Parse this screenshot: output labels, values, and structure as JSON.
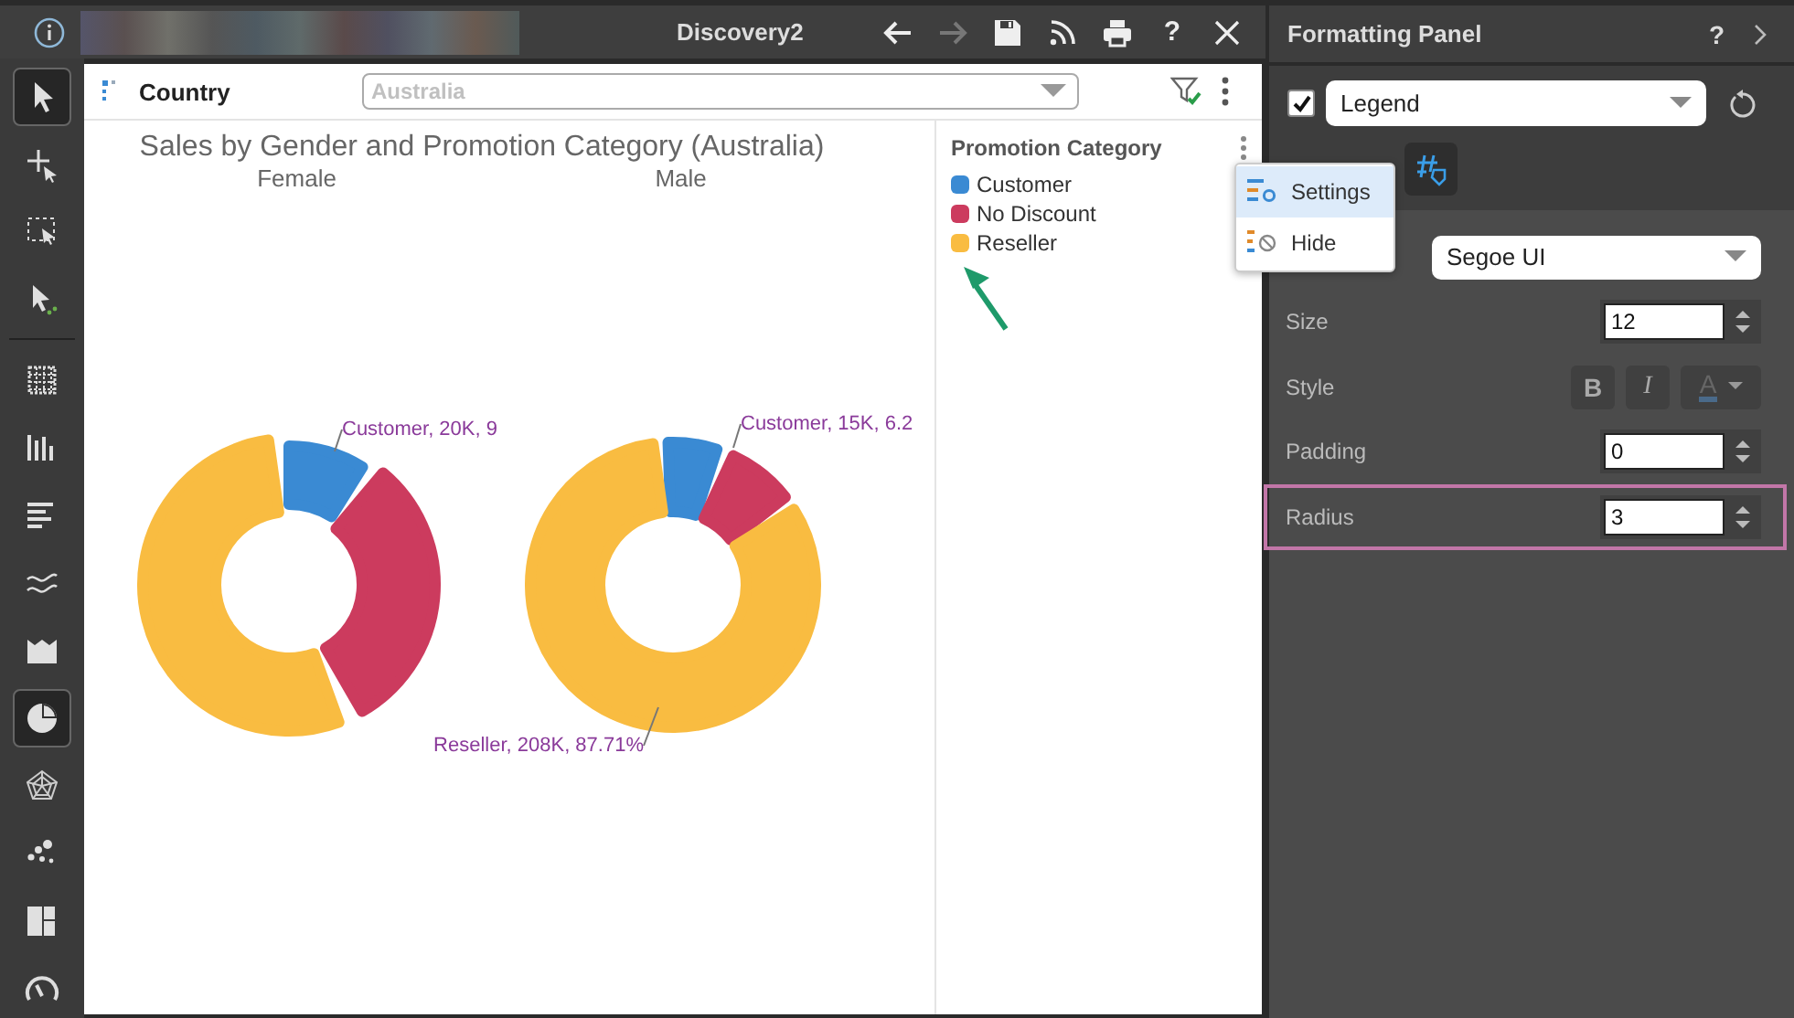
{
  "window": {
    "title": "Discovery2"
  },
  "toolbar_actions": [
    {
      "kind": "back",
      "disabled": false
    },
    {
      "kind": "forward",
      "disabled": true
    },
    {
      "kind": "save",
      "disabled": false
    },
    {
      "kind": "feed",
      "disabled": false
    },
    {
      "kind": "print",
      "disabled": false
    },
    {
      "kind": "help",
      "label": "?",
      "disabled": false
    },
    {
      "kind": "close",
      "disabled": false
    }
  ],
  "tools": [
    {
      "kind": "pointer",
      "selected": true
    },
    {
      "kind": "add-pointer",
      "selected": false
    },
    {
      "kind": "marquee",
      "selected": false
    },
    {
      "kind": "dot-pointer",
      "selected": false
    },
    {
      "kind": "divider"
    },
    {
      "kind": "grid",
      "selected": false
    },
    {
      "kind": "bars",
      "selected": false
    },
    {
      "kind": "hbars",
      "selected": false
    },
    {
      "kind": "lines",
      "selected": false
    },
    {
      "kind": "area",
      "selected": false
    },
    {
      "kind": "pie",
      "selected": true
    },
    {
      "kind": "radar",
      "selected": false
    },
    {
      "kind": "scatter",
      "selected": false
    },
    {
      "kind": "treemap",
      "selected": false
    },
    {
      "kind": "gauge",
      "selected": false
    }
  ],
  "filter": {
    "label": "Country",
    "value": "Australia",
    "disabled": true
  },
  "chart": {
    "title": "Sales by Gender and Promotion Category (Australia)",
    "panels": [
      {
        "subtitle": "Female",
        "labels": [
          "Customer, 20K, 9"
        ]
      },
      {
        "subtitle": "Male",
        "labels": [
          "Customer, 15K, 6.2",
          "Reseller, 208K, 87.71%"
        ]
      }
    ]
  },
  "legend": {
    "title": "Promotion Category",
    "items": [
      {
        "label": "Customer",
        "color": "#3a8ad3"
      },
      {
        "label": "No Discount",
        "color": "#cc3b5e"
      },
      {
        "label": "Reseller",
        "color": "#f9bc41"
      }
    ]
  },
  "context_menu": {
    "items": [
      {
        "label": "Settings",
        "selected": true
      },
      {
        "label": "Hide",
        "selected": false
      }
    ]
  },
  "formatting_panel": {
    "title": "Formatting Panel",
    "help": "?",
    "element": {
      "enabled": true,
      "value": "Legend"
    },
    "font": {
      "value": "Segoe UI"
    },
    "size": {
      "label": "Size",
      "value": "12"
    },
    "style": {
      "label": "Style",
      "bold": "B",
      "italic": "I",
      "color_letter": "A"
    },
    "padding": {
      "label": "Padding",
      "value": "0"
    },
    "radius": {
      "label": "Radius",
      "value": "3",
      "highlighted": true
    }
  }
}
